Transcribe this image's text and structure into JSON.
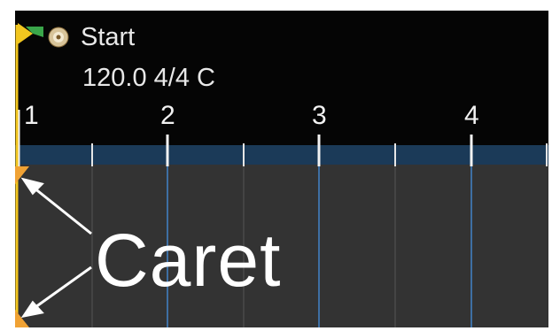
{
  "marker": {
    "name": "Start",
    "icon": "cd-disc-icon"
  },
  "project": {
    "tempo_signature_key": "120.0 4/4 C"
  },
  "ruler": {
    "bars": [
      "1",
      "2",
      "3",
      "4"
    ]
  },
  "annotation": {
    "label": "Caret"
  },
  "colors": {
    "playhead": "#f2c61f",
    "flag": "#3aa64a",
    "ruler_strip": "#1b3a58",
    "gridline": "#3e6fa3",
    "track_bg": "#333333",
    "caret": "#f0a234"
  }
}
